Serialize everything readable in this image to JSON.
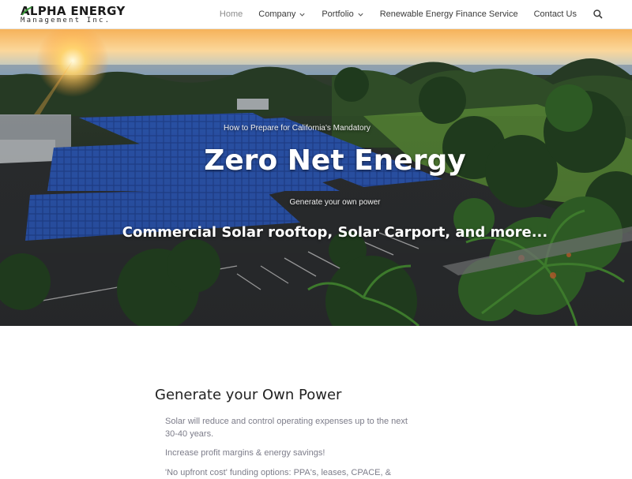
{
  "logo": {
    "name": "ALPHA ENERGY",
    "subtitle": "Management Inc."
  },
  "nav": {
    "items": [
      {
        "label": "Home",
        "active": true,
        "dropdown": false
      },
      {
        "label": "Company",
        "active": false,
        "dropdown": true
      },
      {
        "label": "Portfolio",
        "active": false,
        "dropdown": true
      },
      {
        "label": "Renewable Energy Finance Service",
        "active": false,
        "dropdown": false
      },
      {
        "label": "Contact Us",
        "active": false,
        "dropdown": false
      }
    ],
    "search_icon": "search-icon"
  },
  "hero": {
    "pretitle": "How to Prepare for California's Mandatory",
    "title": "Zero Net Energy",
    "subtitle": "Generate your own power",
    "tagline": "Commercial Solar rooftop, Solar Carport, and more..."
  },
  "section": {
    "title": "Generate your Own Power",
    "paragraphs": [
      "Solar will reduce and control operating expenses up to the next 30-40 years.",
      "Increase profit margins & energy savings!",
      "'No upfront cost' funding options: PPA's, leases, CPACE, &"
    ]
  },
  "colors": {
    "nav_text": "#3a3a3a",
    "nav_active": "#8c8c8c",
    "heading": "#222222",
    "body_text": "#7d7d8a"
  }
}
